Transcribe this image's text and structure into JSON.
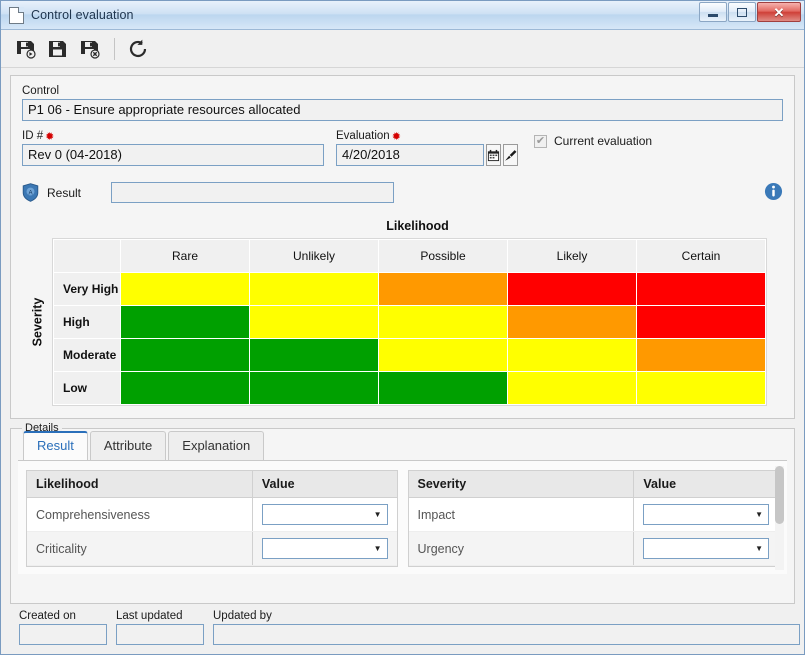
{
  "window": {
    "title": "Control evaluation",
    "doc_icon": "document-icon",
    "controls": {
      "minimize": "minimize-icon",
      "restore": "restore-icon",
      "close": "✕"
    }
  },
  "toolbar": {
    "buttons": [
      {
        "name": "save-and-new",
        "icon": "save-new-icon"
      },
      {
        "name": "save",
        "icon": "save-icon"
      },
      {
        "name": "save-and-close",
        "icon": "save-close-icon"
      },
      {
        "name": "refresh",
        "icon": "refresh-icon"
      }
    ]
  },
  "form": {
    "control": {
      "label": "Control",
      "value": "P1 06 - Ensure appropriate resources allocated",
      "placeholder": ""
    },
    "id": {
      "label": "ID #",
      "required_marker": "✹",
      "value": "Rev 0 (04-2018)",
      "placeholder": ""
    },
    "evaluation": {
      "label": "Evaluation",
      "required_marker": "✹",
      "value": "4/20/2018",
      "placeholder": "",
      "calendar_icon": "calendar-icon",
      "clear_icon": "brush-icon"
    },
    "current_evaluation": {
      "label": "Current evaluation",
      "checked": true,
      "check_glyph": "✔"
    },
    "result": {
      "label": "Result",
      "badge_icon": "shield-icon",
      "value": "",
      "placeholder": ""
    },
    "info_icon": "info-icon"
  },
  "chart_data": {
    "type": "heatmap",
    "title": "Likelihood",
    "xlabel": "Likelihood",
    "ylabel": "Severity",
    "categories": [
      "Rare",
      "Unlikely",
      "Possible",
      "Likely",
      "Certain"
    ],
    "rows": [
      "Very High",
      "High",
      "Moderate",
      "Low"
    ],
    "legend": [],
    "colors": {
      "green": "#00A000",
      "yellow": "#FFFF00",
      "orange": "#FF9900",
      "red": "#FF0000"
    },
    "cells": [
      [
        "yellow",
        "yellow",
        "orange",
        "red",
        "red"
      ],
      [
        "green",
        "yellow",
        "yellow",
        "orange",
        "red"
      ],
      [
        "green",
        "green",
        "yellow",
        "yellow",
        "orange"
      ],
      [
        "green",
        "green",
        "green",
        "yellow",
        "yellow"
      ]
    ],
    "values": [
      [
        2,
        2,
        3,
        4,
        4
      ],
      [
        1,
        2,
        2,
        3,
        4
      ],
      [
        1,
        1,
        2,
        2,
        3
      ],
      [
        1,
        1,
        1,
        2,
        2
      ]
    ]
  },
  "details": {
    "caption": "Details",
    "tabs": [
      {
        "label": "Result",
        "active": true
      },
      {
        "label": "Attribute",
        "active": false
      },
      {
        "label": "Explanation",
        "active": false
      }
    ],
    "left_table": {
      "headers": [
        "Likelihood",
        "Value"
      ],
      "rows": [
        {
          "name": "Comprehensiveness",
          "value": ""
        },
        {
          "name": "Criticality",
          "value": ""
        }
      ]
    },
    "right_table": {
      "headers": [
        "Severity",
        "Value"
      ],
      "rows": [
        {
          "name": "Impact",
          "value": ""
        },
        {
          "name": "Urgency",
          "value": ""
        }
      ]
    },
    "dropdown_arrow": "▼",
    "scrollbar": "vertical-scrollbar"
  },
  "footer": {
    "created_on": {
      "label": "Created on",
      "value": ""
    },
    "last_updated": {
      "label": "Last updated",
      "value": ""
    },
    "updated_by": {
      "label": "Updated by",
      "value": ""
    }
  }
}
